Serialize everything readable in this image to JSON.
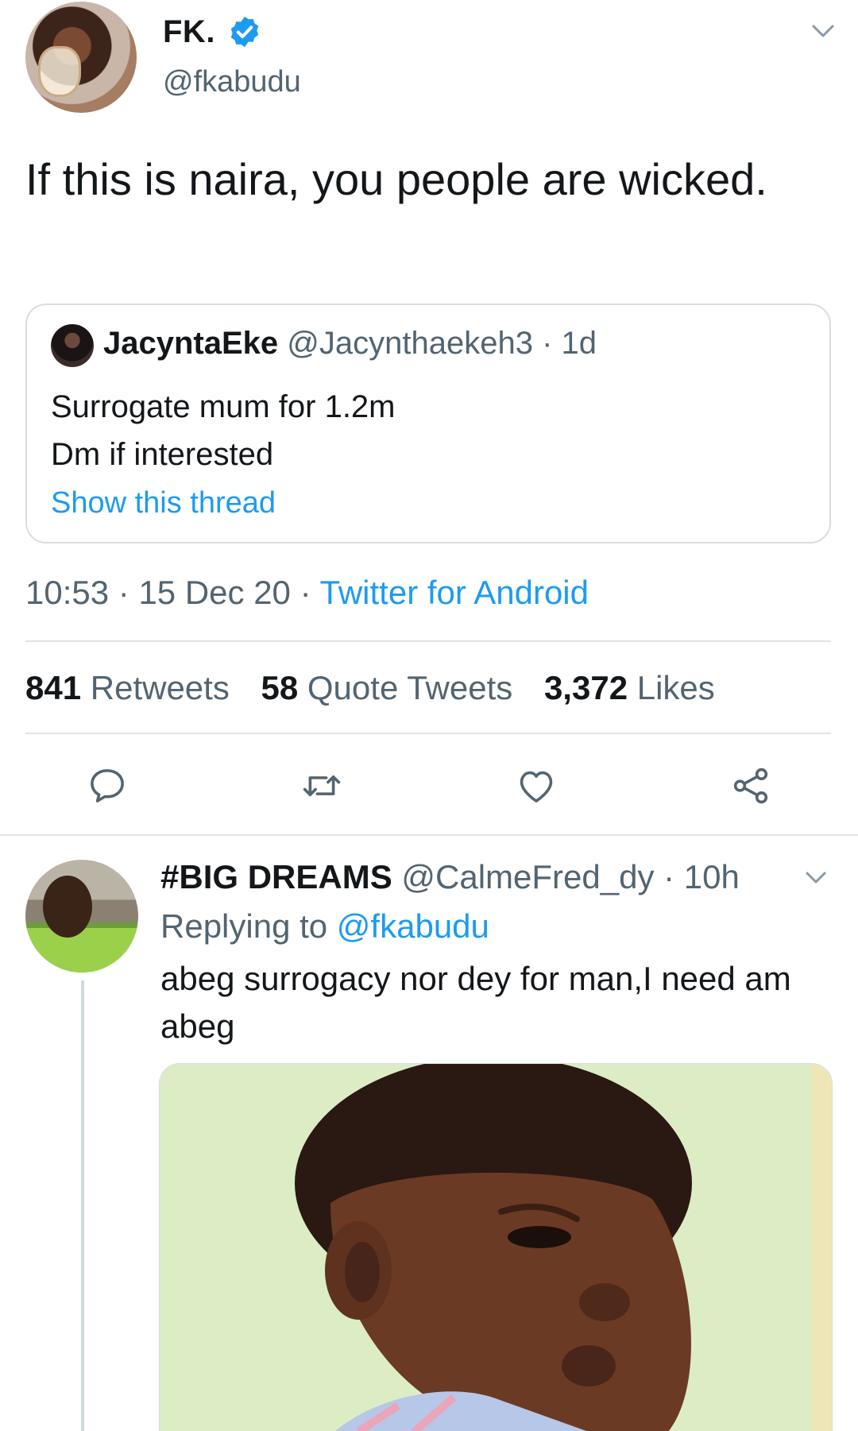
{
  "tweet": {
    "author_name": "FK.",
    "author_handle": "@fkabudu",
    "text": "If this is naira, you people are wicked.",
    "time": "10:53",
    "date": "15 Dec 20",
    "source": "Twitter for Android",
    "separator": "·"
  },
  "quote": {
    "author_name": "JacyntaEke",
    "author_handle": "@Jacynthaekeh3",
    "age": "1d",
    "line1": "Surrogate mum for 1.2m",
    "line2": "Dm if interested",
    "show_thread": "Show this thread"
  },
  "stats": {
    "retweets_count": "841",
    "retweets_label": "Retweets",
    "quotes_count": "58",
    "quotes_label": "Quote Tweets",
    "likes_count": "3,372",
    "likes_label": "Likes"
  },
  "reply": {
    "author_name": "#BIG DREAMS",
    "author_handle": "@CalmeFred_dy",
    "age": "10h",
    "replying_prefix": "Replying to",
    "replying_to": "@fkabudu",
    "text": "abeg surrogacy nor dey for man,I need am abeg"
  },
  "colors": {
    "accent": "#1d9bf0",
    "secondary_text": "#536471",
    "divider": "#dfe4e8"
  },
  "icons": [
    "verified-badge-icon",
    "chevron-down-icon",
    "reply-icon",
    "retweet-icon",
    "like-icon",
    "share-icon"
  ]
}
